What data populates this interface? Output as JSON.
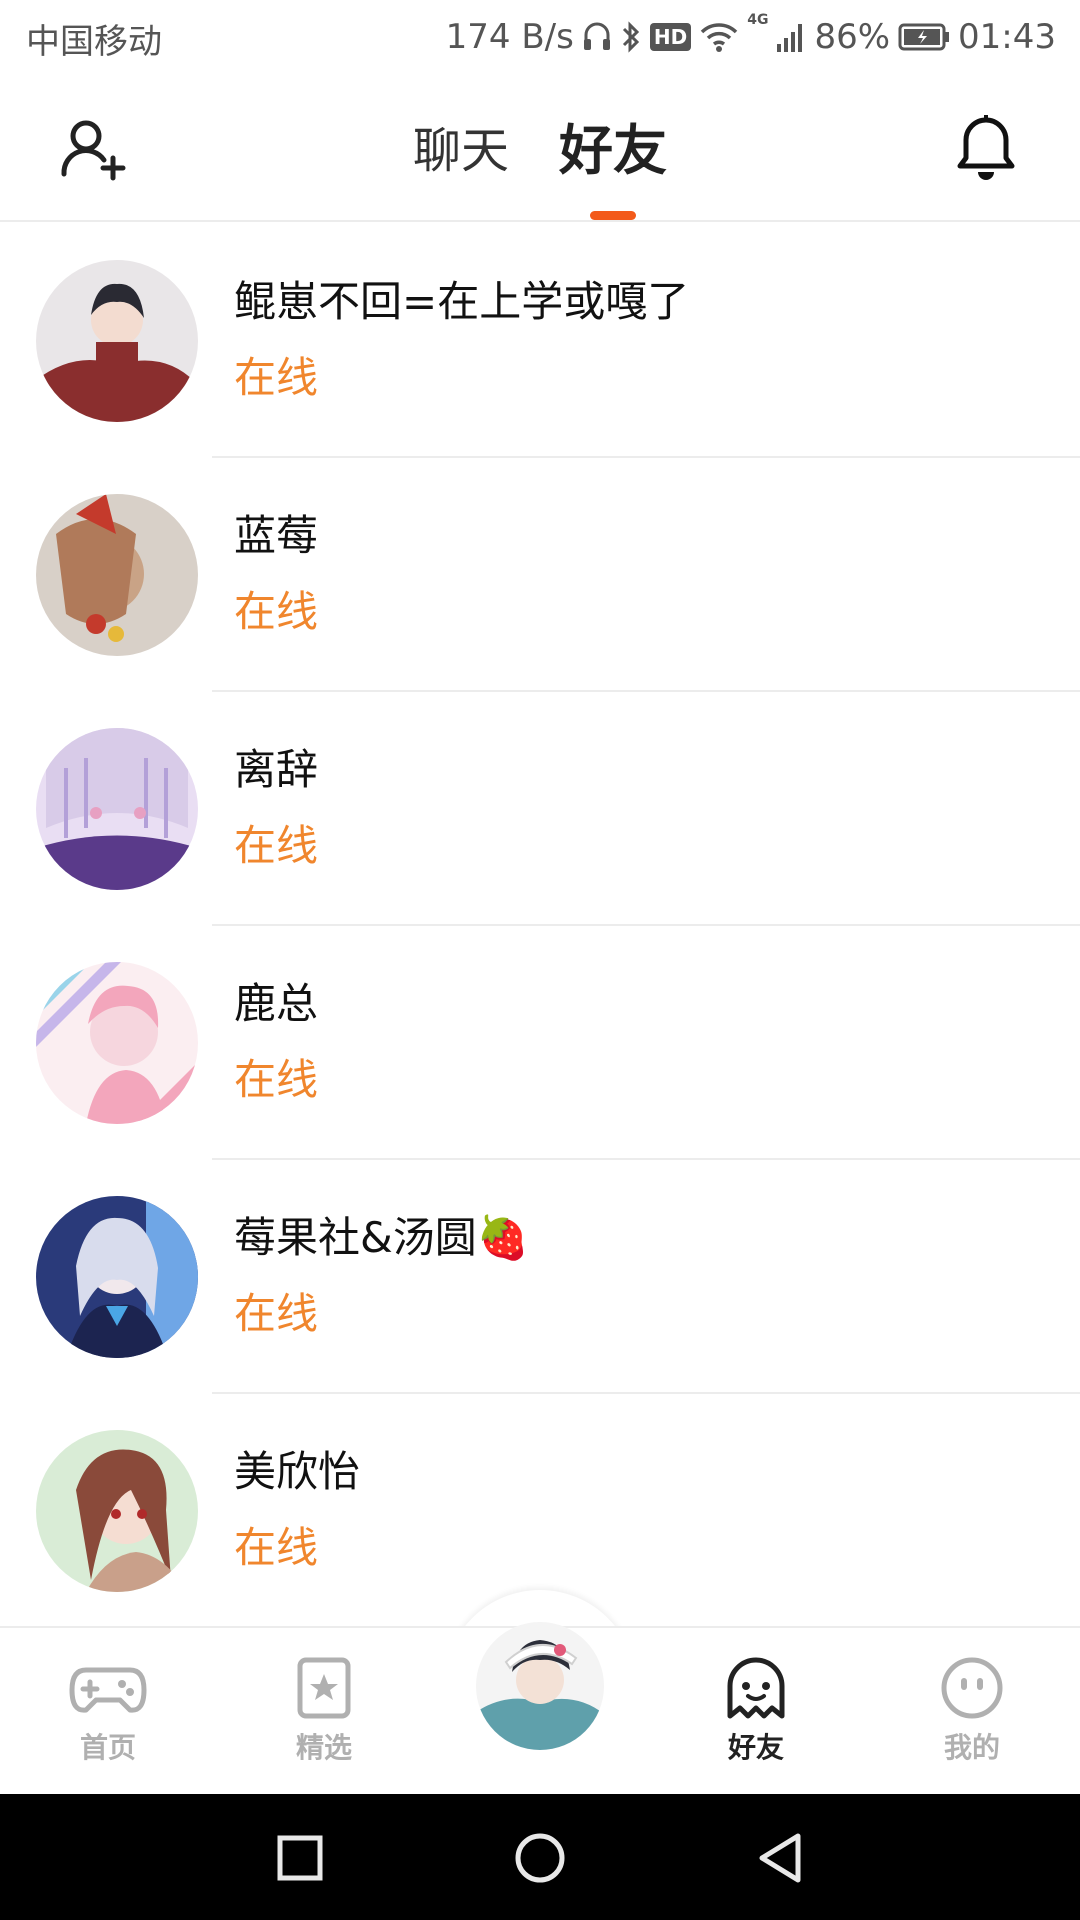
{
  "status_bar": {
    "carrier": "中国移动",
    "net_speed": "174 B/s",
    "battery": "86%",
    "time": "01:43",
    "signal_label": "4G",
    "hd_label": "HD"
  },
  "header": {
    "tabs": [
      {
        "label": "聊天",
        "active": false
      },
      {
        "label": "好友",
        "active": true
      }
    ],
    "accent_color": "#f35a1a"
  },
  "friends": [
    {
      "name": "鲲崽不回=在上学或嘎了",
      "status": "在线",
      "avatar_colors": [
        "#e9e6e8",
        "#8a2e2e",
        "#2a2a33"
      ]
    },
    {
      "name": "蓝莓",
      "status": "在线",
      "avatar_colors": [
        "#d8d0c8",
        "#b07a5a",
        "#c43a2c"
      ]
    },
    {
      "name": "离辞",
      "status": "在线",
      "avatar_colors": [
        "#e9def3",
        "#b3a0d8",
        "#5a3a8a"
      ]
    },
    {
      "name": "鹿总",
      "status": "在线",
      "avatar_colors": [
        "#f6d6de",
        "#f3a6bc",
        "#9ad4ea"
      ]
    },
    {
      "name": "莓果社&汤圆🍓",
      "status": "在线",
      "avatar_colors": [
        "#2a3a7a",
        "#d8dced",
        "#6fa6e6"
      ]
    },
    {
      "name": "美欣怡",
      "status": "在线",
      "avatar_colors": [
        "#d9ecd6",
        "#8a4a3a",
        "#c9a08a"
      ]
    }
  ],
  "bottom_nav": {
    "items": [
      {
        "label": "首页",
        "icon": "gamepad-icon",
        "active": false
      },
      {
        "label": "精选",
        "icon": "star-card-icon",
        "active": false
      },
      {
        "label": "好友",
        "icon": "ghost-icon",
        "active": true
      },
      {
        "label": "我的",
        "icon": "smiley-icon",
        "active": false
      }
    ],
    "center_icon": "profile-avatar"
  },
  "system_nav": [
    "recent-apps-icon",
    "home-icon",
    "back-icon"
  ],
  "colors": {
    "online": "#f0862d",
    "active_tab": "#f56a1e",
    "inactive_nav": "#b0b0b0"
  }
}
